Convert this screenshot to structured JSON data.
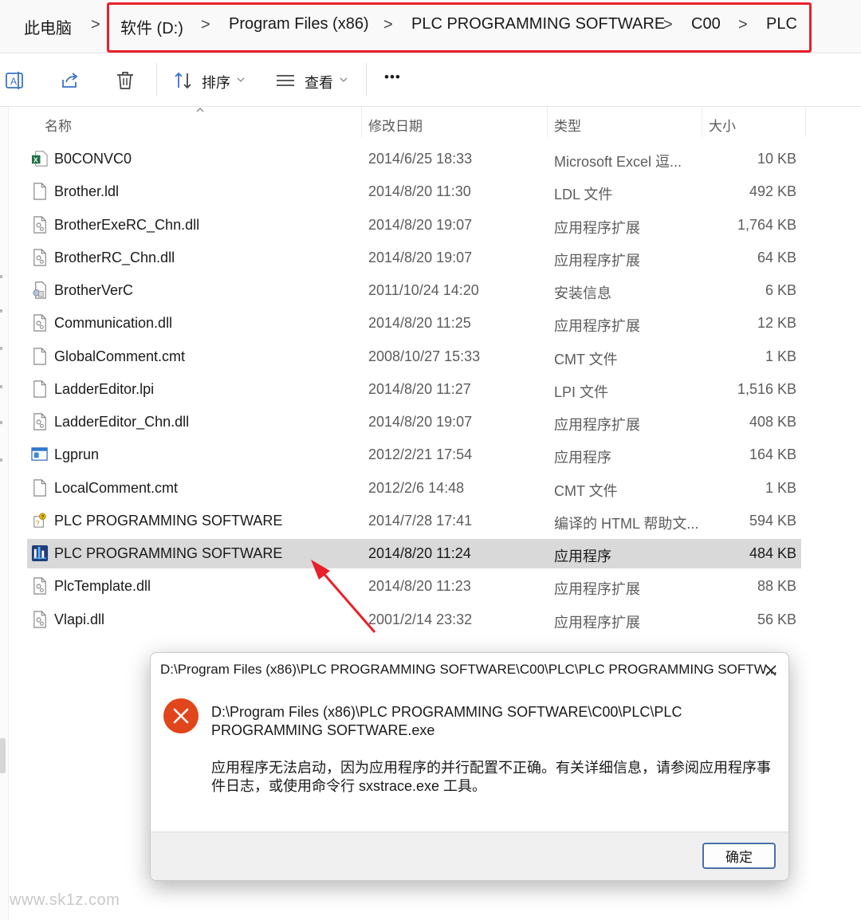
{
  "breadcrumb": {
    "items": [
      "此电脑",
      "软件 (D:)",
      "Program Files (x86)",
      "PLC PROGRAMMING SOFTWARE",
      "C00",
      "PLC"
    ],
    "separator": ">"
  },
  "toolbar": {
    "sort_label": "排序",
    "view_label": "查看",
    "more_label": "•••"
  },
  "columns": {
    "name": "名称",
    "date": "修改日期",
    "type": "类型",
    "size": "大小"
  },
  "files": [
    {
      "name": "B0CONVC0",
      "date": "2014/6/25 18:33",
      "type": "Microsoft Excel 逗...",
      "size": "10 KB",
      "icon": "excel-file-icon"
    },
    {
      "name": "Brother.ldl",
      "date": "2014/8/20 11:30",
      "type": "LDL 文件",
      "size": "492 KB",
      "icon": "blank-file-icon"
    },
    {
      "name": "BrotherExeRC_Chn.dll",
      "date": "2014/8/20 19:07",
      "type": "应用程序扩展",
      "size": "1,764 KB",
      "icon": "dll-file-icon"
    },
    {
      "name": "BrotherRC_Chn.dll",
      "date": "2014/8/20 19:07",
      "type": "应用程序扩展",
      "size": "64 KB",
      "icon": "dll-file-icon"
    },
    {
      "name": "BrotherVerC",
      "date": "2011/10/24 14:20",
      "type": "安装信息",
      "size": "6 KB",
      "icon": "setup-info-icon"
    },
    {
      "name": "Communication.dll",
      "date": "2014/8/20 11:25",
      "type": "应用程序扩展",
      "size": "12 KB",
      "icon": "dll-file-icon"
    },
    {
      "name": "GlobalComment.cmt",
      "date": "2008/10/27 15:33",
      "type": "CMT 文件",
      "size": "1 KB",
      "icon": "blank-file-icon"
    },
    {
      "name": "LadderEditor.lpi",
      "date": "2014/8/20 11:27",
      "type": "LPI 文件",
      "size": "1,516 KB",
      "icon": "blank-file-icon"
    },
    {
      "name": "LadderEditor_Chn.dll",
      "date": "2014/8/20 19:07",
      "type": "应用程序扩展",
      "size": "408 KB",
      "icon": "dll-file-icon"
    },
    {
      "name": "Lgprun",
      "date": "2012/2/21 17:54",
      "type": "应用程序",
      "size": "164 KB",
      "icon": "app-window-icon"
    },
    {
      "name": "LocalComment.cmt",
      "date": "2012/2/6 14:48",
      "type": "CMT 文件",
      "size": "1 KB",
      "icon": "blank-file-icon"
    },
    {
      "name": "PLC PROGRAMMING SOFTWARE",
      "date": "2014/7/28 17:41",
      "type": "编译的 HTML 帮助文...",
      "size": "594 KB",
      "icon": "chm-help-icon"
    },
    {
      "name": "PLC PROGRAMMING SOFTWARE",
      "date": "2014/8/20 11:24",
      "type": "应用程序",
      "size": "484 KB",
      "icon": "plc-app-icon",
      "selected": true
    },
    {
      "name": "PlcTemplate.dll",
      "date": "2014/8/20 11:23",
      "type": "应用程序扩展",
      "size": "88 KB",
      "icon": "dll-file-icon"
    },
    {
      "name": "Vlapi.dll",
      "date": "2001/2/14 23:32",
      "type": "应用程序扩展",
      "size": "56 KB",
      "icon": "dll-file-icon"
    }
  ],
  "dialog": {
    "title": "D:\\Program Files (x86)\\PLC PROGRAMMING SOFTWARE\\C00\\PLC\\PLC PROGRAMMING SOFTW...",
    "path_message": "D:\\Program Files (x86)\\PLC PROGRAMMING SOFTWARE\\C00\\PLC\\PLC PROGRAMMING SOFTWARE.exe",
    "detail_message": "应用程序无法启动，因为应用程序的并行配置不正确。有关详细信息，请参阅应用程序事件日志，或使用命令行 sxstrace.exe 工具。",
    "ok_label": "确定"
  },
  "watermark": "www.sk1z.com",
  "colors": {
    "highlight_red": "#e8202a",
    "error_red": "#e0451b",
    "selected_row": "#d9d9d9"
  }
}
